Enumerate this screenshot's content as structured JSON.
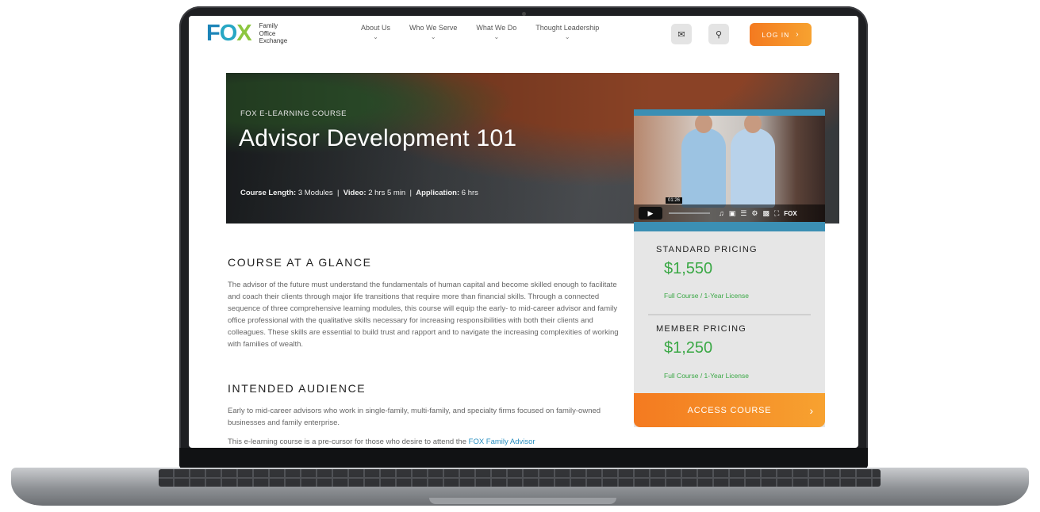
{
  "header": {
    "logo_mark": [
      "F",
      "O",
      "X"
    ],
    "logo_text": [
      "Family",
      "Office",
      "Exchange"
    ],
    "nav": [
      {
        "label": "About Us"
      },
      {
        "label": "Who We Serve"
      },
      {
        "label": "What We Do"
      },
      {
        "label": "Thought Leadership"
      }
    ],
    "login_label": "LOG IN"
  },
  "hero": {
    "eyebrow": "FOX E-LEARNING COURSE",
    "title": "Advisor Development 101",
    "meta": {
      "length_label": "Course Length:",
      "length_value": "3 Modules",
      "video_label": "Video:",
      "video_value": "2 hrs 5 min",
      "application_label": "Application:",
      "application_value": "6 hrs"
    }
  },
  "video": {
    "time": "01:26",
    "watermark": "FOX"
  },
  "pricing": {
    "standard": {
      "label": "STANDARD PRICING",
      "price": "$1,550",
      "note": "Full Course / 1-Year License"
    },
    "member": {
      "label": "MEMBER PRICING",
      "price": "$1,250",
      "note": "Full Course / 1-Year License"
    },
    "cta": "ACCESS COURSE"
  },
  "content": {
    "glance_heading": "COURSE AT A GLANCE",
    "glance_text": "The advisor of the future must understand the fundamentals of human capital and become skilled enough to facilitate and coach their clients through major life transitions that require more than financial skills. Through a connected sequence of three comprehensive learning modules, this course will equip the early- to mid-career advisor and family office professional with the qualitative skills necessary for increasing responsibilities with both their clients and colleagues. These skills are essential to build trust and rapport and to navigate the increasing complexities of working with families of wealth.",
    "audience_heading": "INTENDED AUDIENCE",
    "audience_text": "Early to mid-career advisors who work in single-family, multi-family, and specialty firms focused on family-owned businesses and family enterprise.",
    "precursor_text": "This e-learning course is a pre-cursor for those who desire to attend the",
    "precursor_link": "FOX Family Advisor"
  }
}
